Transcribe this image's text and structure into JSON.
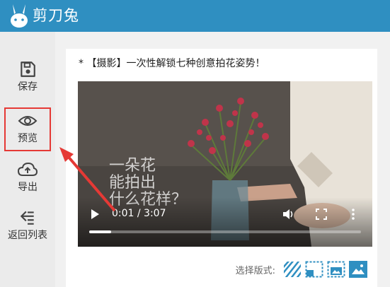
{
  "app": {
    "title": "剪刀兔"
  },
  "sidebar": {
    "items": [
      {
        "label": "保存",
        "icon": "save-icon"
      },
      {
        "label": "预览",
        "icon": "eye-icon",
        "active": true
      },
      {
        "label": "导出",
        "icon": "cloud-upload-icon"
      },
      {
        "label": "返回列表",
        "icon": "list-back-icon"
      }
    ]
  },
  "card": {
    "title": "* 【摄影】一次性解锁七种创意拍花姿势！"
  },
  "video": {
    "overlay_lines": [
      "一朵花",
      "能拍出",
      "什么花样？"
    ],
    "time": "0:01 / 3:07",
    "progress_percent": 8
  },
  "layout": {
    "label": "选择版式:",
    "options": [
      "diagonal-pattern-icon",
      "frame-left-icon",
      "frame-image-icon",
      "landscape-image-icon"
    ],
    "selected_index": 3
  },
  "colors": {
    "topbar": "#2f8fc1",
    "accent": "#2f8fc1",
    "highlight": "#e53935"
  }
}
